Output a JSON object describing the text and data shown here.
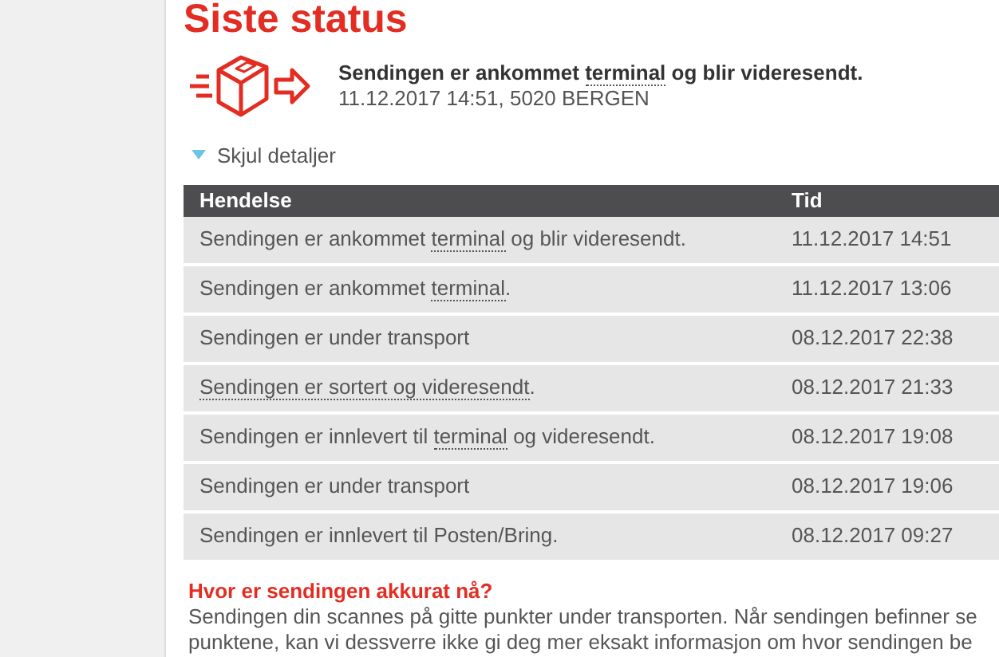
{
  "title": "Siste status",
  "latest": {
    "message": [
      {
        "text": "Sendingen er ankommet "
      },
      {
        "text": "terminal",
        "kind": "term"
      },
      {
        "text": " og blir videresendt."
      }
    ],
    "detail": "11.12.2017 14:51, 5020 BERGEN"
  },
  "details_toggle": {
    "label": "Skjul detaljer",
    "expanded": true
  },
  "table": {
    "columns": [
      "Hendelse",
      "Tid"
    ],
    "rows": [
      {
        "event": [
          {
            "text": "Sendingen er ankommet "
          },
          {
            "text": "terminal",
            "kind": "term"
          },
          {
            "text": " og blir videresendt."
          }
        ],
        "time": "11.12.2017 14:51"
      },
      {
        "event": [
          {
            "text": "Sendingen er ankommet "
          },
          {
            "text": "terminal",
            "kind": "term"
          },
          {
            "text": "."
          }
        ],
        "time": "11.12.2017 13:06"
      },
      {
        "event": [
          {
            "text": "Sendingen er under transport"
          }
        ],
        "time": "08.12.2017 22:38"
      },
      {
        "event": [
          {
            "text": "Sendingen er sortert og videresendt",
            "kind": "term"
          },
          {
            "text": "."
          }
        ],
        "time": "08.12.2017 21:33"
      },
      {
        "event": [
          {
            "text": "Sendingen er innlevert til "
          },
          {
            "text": "terminal",
            "kind": "term"
          },
          {
            "text": " og videresendt."
          }
        ],
        "time": "08.12.2017 19:08"
      },
      {
        "event": [
          {
            "text": "Sendingen er under transport"
          }
        ],
        "time": "08.12.2017 19:06"
      },
      {
        "event": [
          {
            "text": "Sendingen er innlevert til Posten/Bring."
          }
        ],
        "time": "08.12.2017 09:27"
      }
    ]
  },
  "info": {
    "heading": "Hvor er sendingen akkurat nå?",
    "lines": [
      "Sendingen din scannes på gitte punkter under transporten. Når sendingen befinner se",
      "punktene, kan vi dessverre ikke gi deg mer eksakt informasjon om hvor sendingen be"
    ]
  }
}
